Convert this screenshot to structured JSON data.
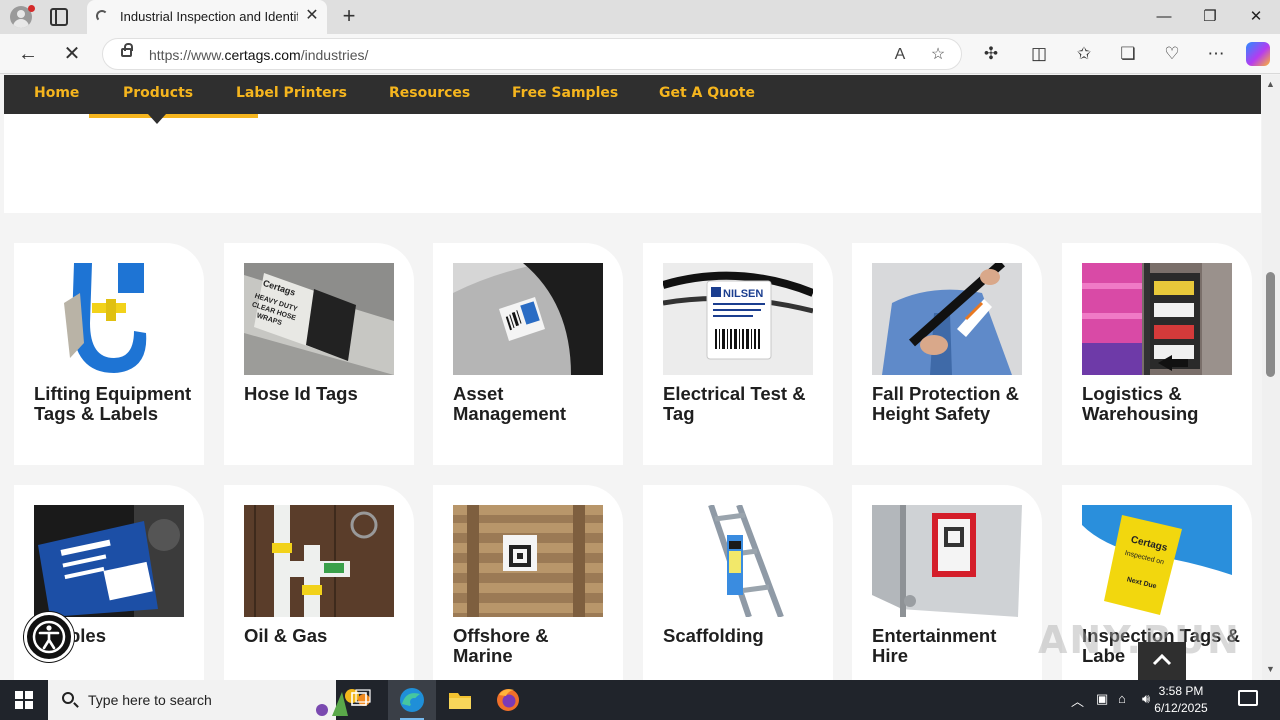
{
  "browser": {
    "tab_title": "Industrial Inspection and Identific",
    "url_prefix": "https://www.",
    "url_host": "certags.com",
    "url_path": "/industries/",
    "new_tab_glyph": "+",
    "close_glyph": "✕",
    "icons": [
      "profile-icon",
      "tab-actions-icon",
      "loading-spinner-icon",
      "back-arrow-icon",
      "stop-loading-icon",
      "lock-icon",
      "read-aloud-icon",
      "favorite-star-icon",
      "extensions-icon",
      "split-screen-icon",
      "favorites-icon",
      "collections-icon",
      "browser-essentials-icon",
      "more-icon",
      "copilot-icon"
    ]
  },
  "site_nav": {
    "items": [
      "Home",
      "Products",
      "Label Printers",
      "Resources",
      "Free Samples",
      "Get A Quote"
    ],
    "active": "Products",
    "accent_color": "#f5b51e",
    "bar_color": "#2f2f2f"
  },
  "industries": [
    {
      "label": "Lifting Equipment Tags & Labels"
    },
    {
      "label": "Hose Id Tags"
    },
    {
      "label": "Asset Management"
    },
    {
      "label": "Electrical Test & Tag"
    },
    {
      "label": "Fall Protection & Height Safety"
    },
    {
      "label": "Logistics & Warehousing"
    },
    {
      "label": "Renewables",
      "visible_text": "ewables"
    },
    {
      "label": "Oil & Gas"
    },
    {
      "label": "Offshore & Marine"
    },
    {
      "label": "Scaffolding"
    },
    {
      "label": "Entertainment Hire"
    },
    {
      "label": "Inspection Tags & Labels",
      "visible_text": "Inspection Tags & Labe"
    }
  ],
  "image_text": {
    "hose": "Certags HEAVY DUTY CLEAR HOSE WRAPS",
    "nilsen": "NILSEN",
    "inspection": "Certags Inspected on Next Due"
  },
  "overlays": {
    "watermark": "ANY.RUN",
    "accessibility_icon": "accessibility-icon",
    "scroll_top_icon": "chevron-up-icon"
  },
  "taskbar": {
    "search_placeholder": "Type here to search",
    "time": "3:58 PM",
    "date": "6/12/2025",
    "icons": [
      "windows-start-icon",
      "search-icon",
      "task-view-icon",
      "edge-icon",
      "file-explorer-icon",
      "firefox-icon",
      "tray-chevron-icon",
      "device-icon",
      "network-icon",
      "volume-icon",
      "notification-icon"
    ]
  }
}
